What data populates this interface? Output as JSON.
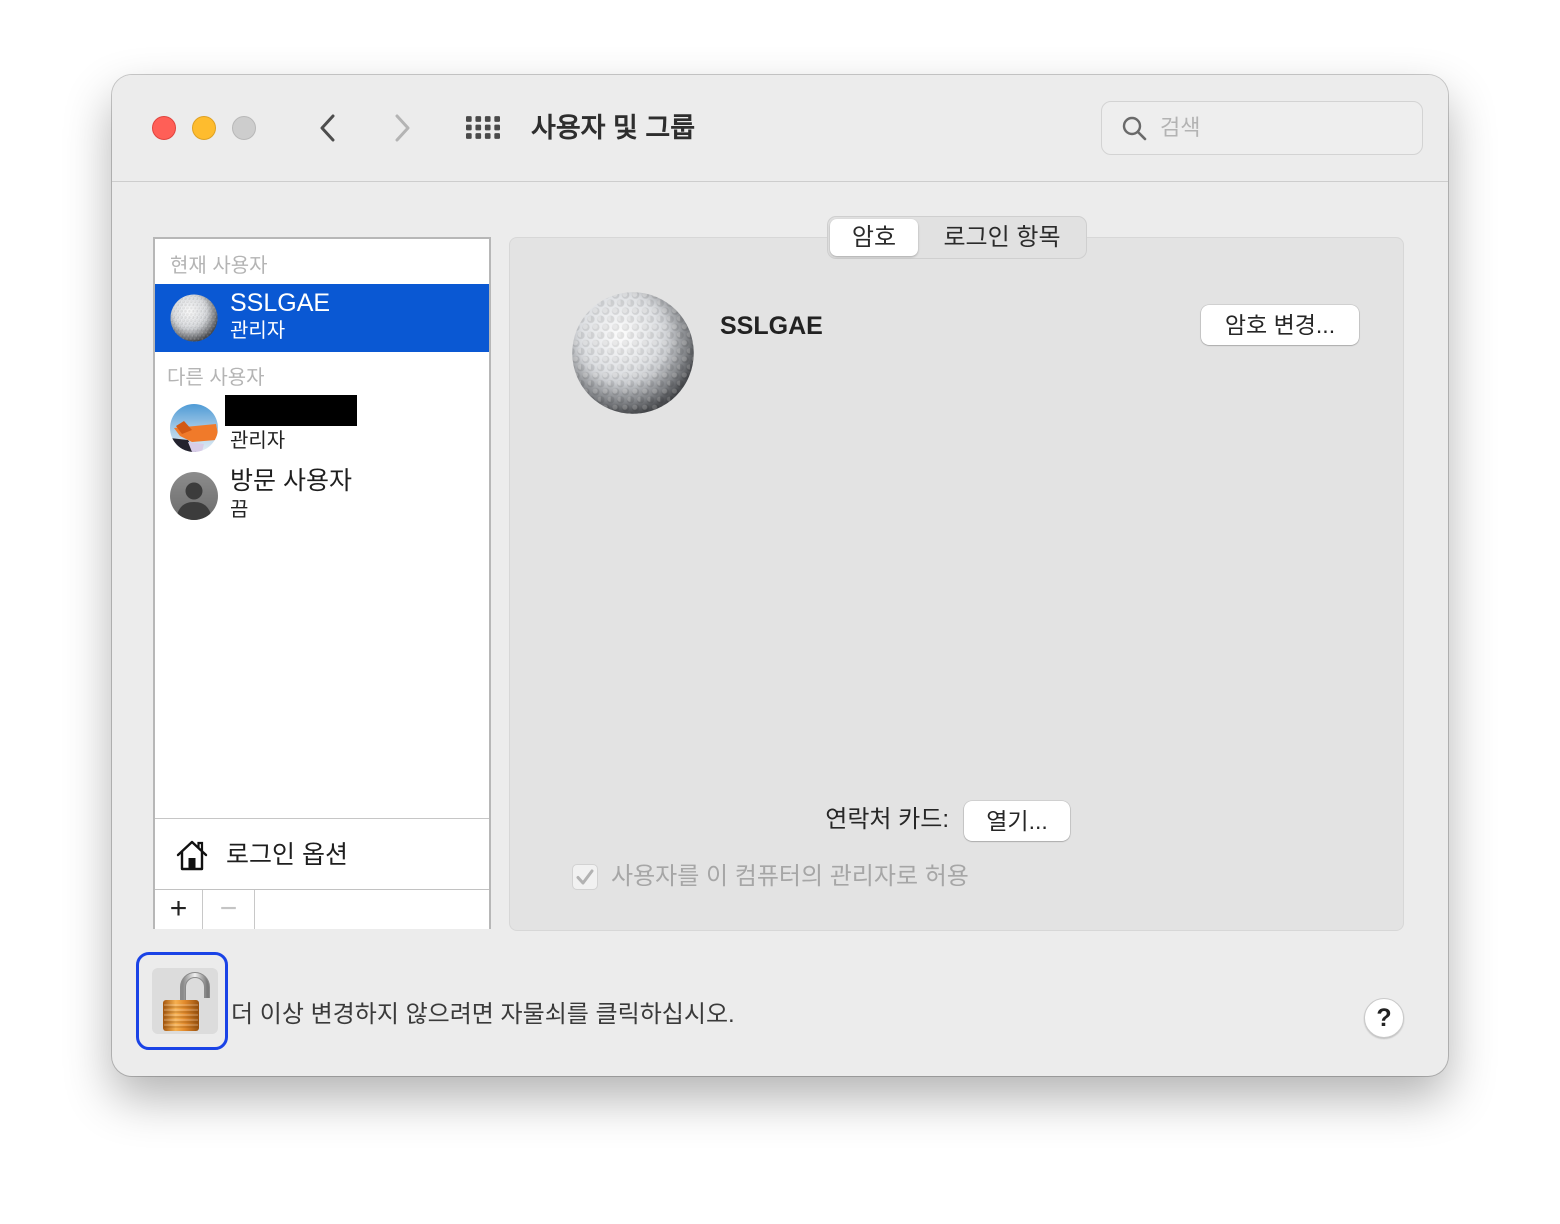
{
  "window": {
    "title": "사용자 및 그룹"
  },
  "toolbar": {
    "back_icon": "chevron-left-icon",
    "forward_icon": "chevron-right-icon",
    "forward_enabled": false,
    "show_all_icon": "grid-icon",
    "search": {
      "icon": "search-icon",
      "placeholder": "검색",
      "value": ""
    }
  },
  "sidebar": {
    "current_header": "현재 사용자",
    "current_user": {
      "name": "SSLGAE",
      "role": "관리자",
      "avatar": "golf-ball-avatar",
      "selected": true
    },
    "other_header": "다른 사용자",
    "other_users": [
      {
        "name_redacted": true,
        "role": "관리자",
        "avatar": "orange-chair-avatar"
      },
      {
        "name": "방문 사용자",
        "role": "끔",
        "avatar": "guest-user-avatar"
      }
    ],
    "login_options": {
      "icon": "house-icon",
      "label": "로그인 옵션"
    },
    "add_button": "+",
    "remove_button": "−",
    "remove_enabled": false
  },
  "tabs": [
    {
      "label": "암호",
      "selected": true
    },
    {
      "label": "로그인 항목",
      "selected": false
    }
  ],
  "detail": {
    "avatar": "golf-ball-avatar",
    "user_name": "SSLGAE",
    "change_password_button": "암호 변경...",
    "contact_card_label": "연락처 카드:",
    "open_button": "열기...",
    "admin_checkbox": {
      "label": "사용자를 이 컴퓨터의 관리자로 허용",
      "checked": true,
      "enabled": false
    }
  },
  "footer": {
    "lock_icon": "lock-open-icon",
    "lock_message": "더 이상 변경하지 않으려면 자물쇠를 클릭하십시오.",
    "help_button": "?"
  },
  "colors": {
    "accent": "#0a58d3",
    "focus_ring": "#1a43e6",
    "window_bg": "#ececec",
    "panel_bg": "#e3e3e3",
    "close_button": "#ff5f57",
    "minimize_button": "#febc2e",
    "zoom_button": "#cdcdcd"
  }
}
